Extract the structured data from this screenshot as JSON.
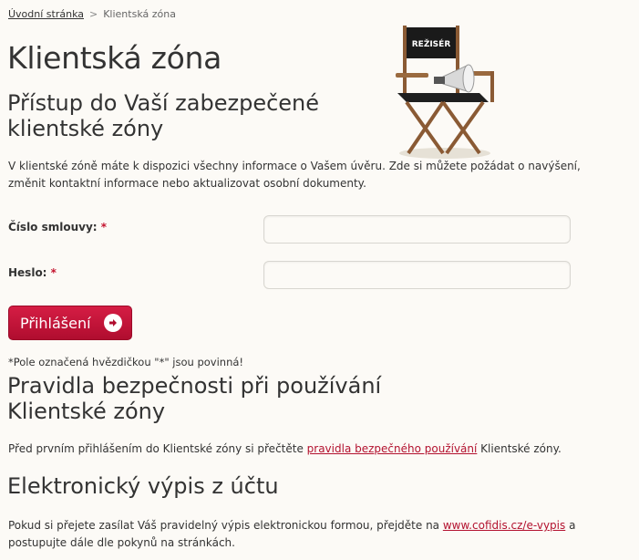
{
  "breadcrumb": {
    "home": "Úvodní stránka",
    "separator": ">",
    "current": "Klientská zóna"
  },
  "page_title": "Klientská zóna",
  "access": {
    "heading": "Přístup do Vaší zabezpečené klientské zóny",
    "intro": "V klientské zóně máte k dispozici všechny informace o Vašem úvěru. Zde si můžete požádat o navýšení, změnit kontaktní informace nebo aktualizovat osobní dokumenty."
  },
  "form": {
    "contract_label": "Číslo smlouvy:",
    "password_label": "Heslo:",
    "required_mark": "*",
    "contract_value": "",
    "password_value": "",
    "login_button": "Přihlášení",
    "required_note": "*Pole označená hvězdičkou \"*\" jsou povinná!"
  },
  "illustration": {
    "chair_text": "REŽISÉR",
    "icon": "director-chair-with-megaphone"
  },
  "security": {
    "heading": "Pravidla bezpečnosti při používání Klientské zóny",
    "text_before": "Před prvním přihlášením do Klientské zóny si přečtěte ",
    "link": "pravidla bezpečného používání",
    "text_after": " Klientské zóny."
  },
  "statement": {
    "heading": "Elektronický výpis z účtu",
    "text_before": "Pokud si přejete zasílat Váš pravidelný výpis elektronickou formou, přejděte na ",
    "link": "www.cofidis.cz/e-vypis",
    "text_after": " a postupujte dále dle pokynů na stránkách."
  },
  "colors": {
    "accent": "#c4142f",
    "background": "#fcfaf6",
    "text": "#333333"
  }
}
